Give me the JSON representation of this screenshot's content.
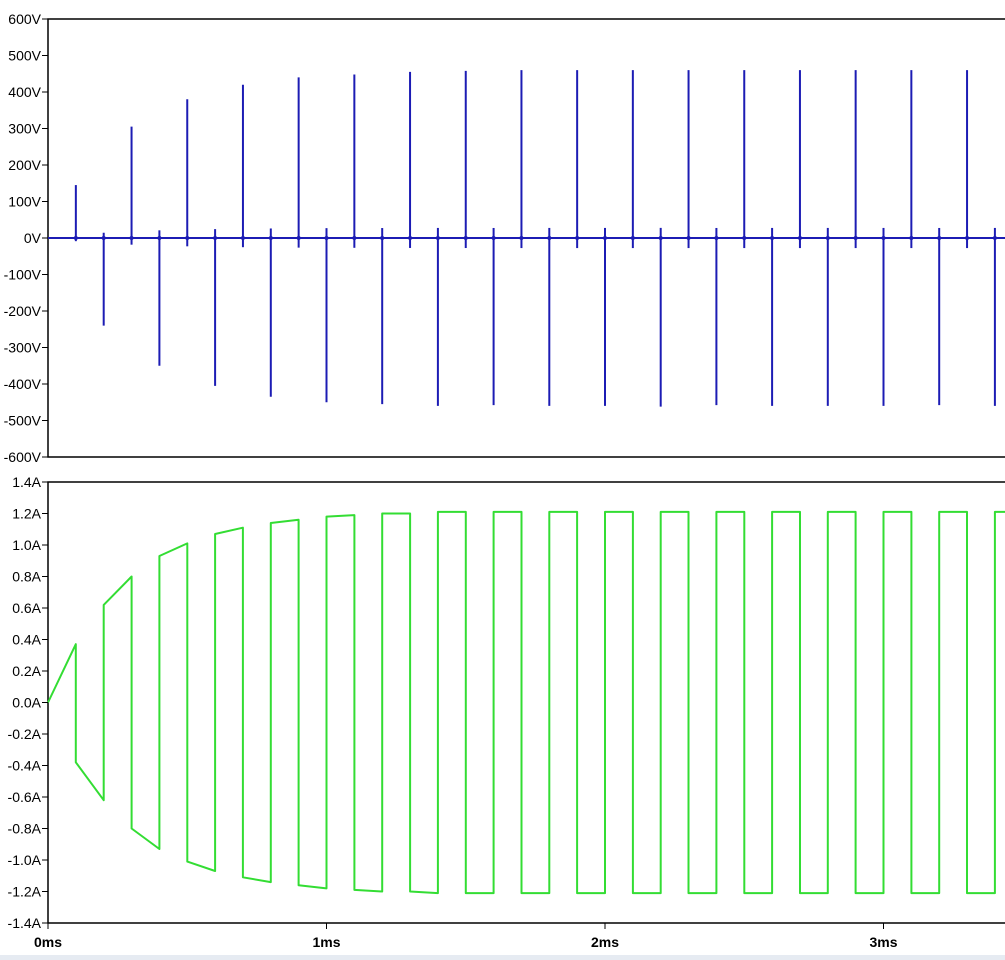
{
  "chart_data": [
    {
      "type": "line",
      "title": "",
      "xlabel": "",
      "ylabel": "",
      "y_tick_labels": [
        "600V",
        "500V",
        "400V",
        "300V",
        "200V",
        "100V",
        "0V",
        "-100V",
        "-200V",
        "-300V",
        "-400V",
        "-500V",
        "-600V"
      ],
      "ylim": [
        -600,
        600
      ],
      "xlim": [
        0,
        3.44
      ],
      "x_unit": "ms",
      "grid": false,
      "color": "#1c1cb4",
      "series": [
        {
          "name": "",
          "spike_times_ms": [
            0.1,
            0.2,
            0.3,
            0.4,
            0.5,
            0.6,
            0.7,
            0.8,
            0.9,
            1.0,
            1.1,
            1.2,
            1.3,
            1.4,
            1.5,
            1.6,
            1.7,
            1.8,
            1.9,
            2.0,
            2.1,
            2.2,
            2.3,
            2.4,
            2.5,
            2.6,
            2.7,
            2.8,
            2.9,
            3.0,
            3.1,
            3.2,
            3.3,
            3.4
          ],
          "spike_peaks_V": [
            145,
            -240,
            305,
            -350,
            380,
            -405,
            420,
            -435,
            440,
            -450,
            448,
            -455,
            455,
            -460,
            458,
            -458,
            460,
            -460,
            460,
            -460,
            460,
            -462,
            460,
            -458,
            460,
            -460,
            460,
            -460,
            460,
            -460,
            460,
            -458,
            460,
            -460
          ]
        }
      ]
    },
    {
      "type": "line",
      "title": "",
      "xlabel": "",
      "ylabel": "",
      "y_tick_labels": [
        "1.4A",
        "1.2A",
        "1.0A",
        "0.8A",
        "0.6A",
        "0.4A",
        "0.2A",
        "0.0A",
        "-0.2A",
        "-0.4A",
        "-0.6A",
        "-0.8A",
        "-1.0A",
        "-1.2A",
        "-1.4A"
      ],
      "x_tick_labels": [
        "0ms",
        "1ms",
        "2ms",
        "3ms"
      ],
      "ylim": [
        -1.4,
        1.4
      ],
      "xlim": [
        0,
        3.44
      ],
      "x_unit": "ms",
      "grid": false,
      "color": "#33dd33",
      "series": [
        {
          "name": "",
          "x_ms": [
            0,
            0.1,
            0.1,
            0.2,
            0.2,
            0.3,
            0.3,
            0.4,
            0.4,
            0.5,
            0.5,
            0.6,
            0.6,
            0.7,
            0.7,
            0.8,
            0.8,
            0.9,
            0.9,
            1.0,
            1.0,
            1.1,
            1.1,
            1.2,
            1.2,
            1.3,
            1.3,
            1.4,
            1.4,
            1.5,
            1.5,
            1.6,
            1.6,
            1.7,
            1.7,
            1.8,
            1.8,
            1.9,
            1.9,
            2.0,
            2.0,
            2.1,
            2.1,
            2.2,
            2.2,
            2.3,
            2.3,
            2.4,
            2.4,
            2.5,
            2.5,
            2.6,
            2.6,
            2.7,
            2.7,
            2.8,
            2.8,
            2.9,
            2.9,
            3.0,
            3.0,
            3.1,
            3.1,
            3.2,
            3.2,
            3.3,
            3.3,
            3.4,
            3.4,
            3.44
          ],
          "y_A": [
            0.0,
            0.37,
            -0.38,
            -0.62,
            0.62,
            0.8,
            -0.8,
            -0.93,
            0.93,
            1.01,
            -1.01,
            -1.07,
            1.07,
            1.11,
            -1.11,
            -1.14,
            1.14,
            1.16,
            -1.16,
            -1.18,
            1.18,
            1.19,
            -1.19,
            -1.2,
            1.2,
            1.2,
            -1.2,
            -1.21,
            1.21,
            1.21,
            -1.21,
            -1.21,
            1.21,
            1.21,
            -1.21,
            -1.21,
            1.21,
            1.21,
            -1.21,
            -1.21,
            1.21,
            1.21,
            -1.21,
            -1.21,
            1.21,
            1.21,
            -1.21,
            -1.21,
            1.21,
            1.21,
            -1.21,
            -1.21,
            1.21,
            1.21,
            -1.21,
            -1.21,
            1.21,
            1.21,
            -1.21,
            -1.21,
            1.21,
            1.21,
            -1.21,
            -1.21,
            1.21,
            1.21,
            -1.21,
            -1.21,
            1.21,
            1.21
          ]
        }
      ]
    }
  ]
}
